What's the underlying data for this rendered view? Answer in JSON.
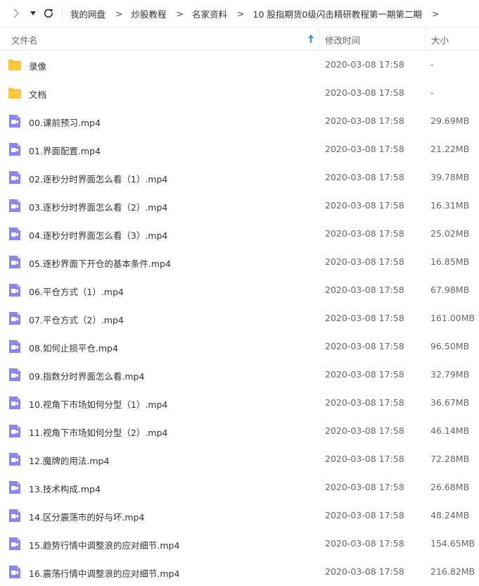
{
  "toolbar": {
    "icons": [
      "chevron-right-icon",
      "caret-down-icon",
      "refresh-icon"
    ]
  },
  "breadcrumb": {
    "items": [
      "我的网盘",
      "炒股教程",
      "名家资料",
      "10 股指期货0级闪击精研教程第一期第二期"
    ],
    "separator": ">"
  },
  "columns": {
    "name": "文件名",
    "time": "修改时间",
    "size": "大小",
    "sort_icon": "sort-ascending-arrow-icon"
  },
  "colors": {
    "folder": "#FFC83D",
    "video": "#8C84F0",
    "sort_arrow": "#2F95F5"
  },
  "files": [
    {
      "type": "folder",
      "name": "录像",
      "time": "2020-03-08 17:58",
      "size": "-"
    },
    {
      "type": "folder",
      "name": "文档",
      "time": "2020-03-08 17:58",
      "size": "-"
    },
    {
      "type": "video",
      "name": "00.课前预习.mp4",
      "time": "2020-03-08 17:58",
      "size": "29.69MB"
    },
    {
      "type": "video",
      "name": "01.界面配置.mp4",
      "time": "2020-03-08 17:58",
      "size": "21.22MB"
    },
    {
      "type": "video",
      "name": "02.逐秒分时界面怎么看（1）.mp4",
      "time": "2020-03-08 17:58",
      "size": "39.78MB"
    },
    {
      "type": "video",
      "name": "03.逐秒分时界面怎么看（2）.mp4",
      "time": "2020-03-08 17:58",
      "size": "16.31MB"
    },
    {
      "type": "video",
      "name": "04.逐秒分时界面怎么看（3）.mp4",
      "time": "2020-03-08 17:58",
      "size": "25.02MB"
    },
    {
      "type": "video",
      "name": "05.逐秒界面下开仓的基本条件.mp4",
      "time": "2020-03-08 17:58",
      "size": "16.85MB"
    },
    {
      "type": "video",
      "name": "06.平仓方式（1）.mp4",
      "time": "2020-03-08 17:58",
      "size": "67.98MB"
    },
    {
      "type": "video",
      "name": "07.平仓方式（2）.mp4",
      "time": "2020-03-08 17:58",
      "size": "161.00MB"
    },
    {
      "type": "video",
      "name": "08.如何止损平仓.mp4",
      "time": "2020-03-08 17:58",
      "size": "96.50MB"
    },
    {
      "type": "video",
      "name": "09.指数分时界面怎么看.mp4",
      "time": "2020-03-08 17:58",
      "size": "32.79MB"
    },
    {
      "type": "video",
      "name": "10.视角下市场如何分型（1）.mp4",
      "time": "2020-03-08 17:58",
      "size": "36.67MB"
    },
    {
      "type": "video",
      "name": "11.视角下市场如何分型（2）.mp4",
      "time": "2020-03-08 17:58",
      "size": "46.14MB"
    },
    {
      "type": "video",
      "name": "12.魔牌的用法.mp4",
      "time": "2020-03-08 17:58",
      "size": "72.28MB"
    },
    {
      "type": "video",
      "name": "13.技术构成.mp4",
      "time": "2020-03-08 17:58",
      "size": "26.68MB"
    },
    {
      "type": "video",
      "name": "14.区分震荡市的好与坏.mp4",
      "time": "2020-03-08 17:58",
      "size": "48.24MB"
    },
    {
      "type": "video",
      "name": "15.趋势行情中调整浪的应对细节.mp4",
      "time": "2020-03-08 17:58",
      "size": "154.65MB"
    },
    {
      "type": "video",
      "name": "16.震荡行情中调整浪的应对细节.mp4",
      "time": "2020-03-08 17:58",
      "size": "216.82MB"
    }
  ]
}
